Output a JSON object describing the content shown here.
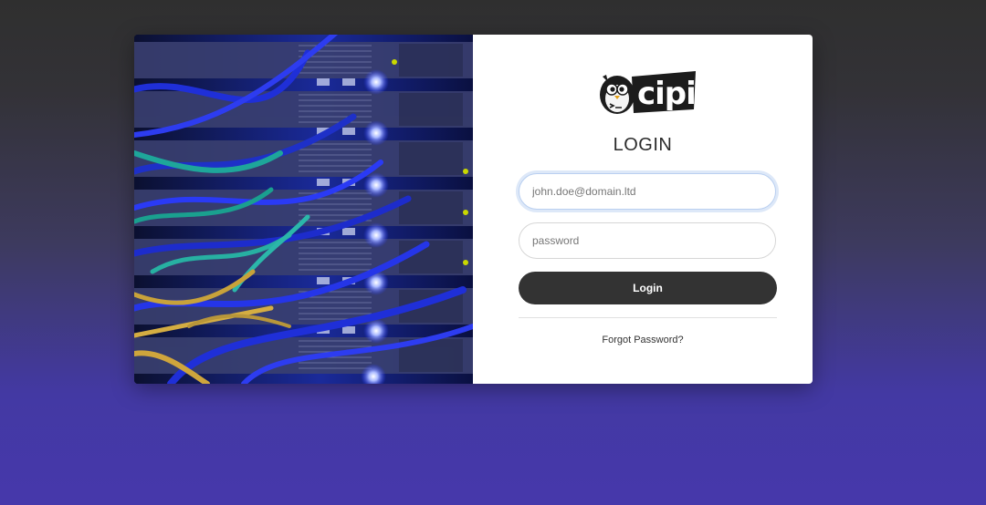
{
  "logo": {
    "text": "cipi",
    "mascot": "penguin-icon"
  },
  "login": {
    "title": "LOGIN",
    "email_placeholder": "john.doe@domain.ltd",
    "password_placeholder": "password",
    "button_label": "Login",
    "forgot_label": "Forgot Password?"
  },
  "colors": {
    "button": "#333333",
    "focus_ring": "#b9cff0",
    "background_top": "#2f2f2f",
    "background_bottom": "#4638ab"
  }
}
